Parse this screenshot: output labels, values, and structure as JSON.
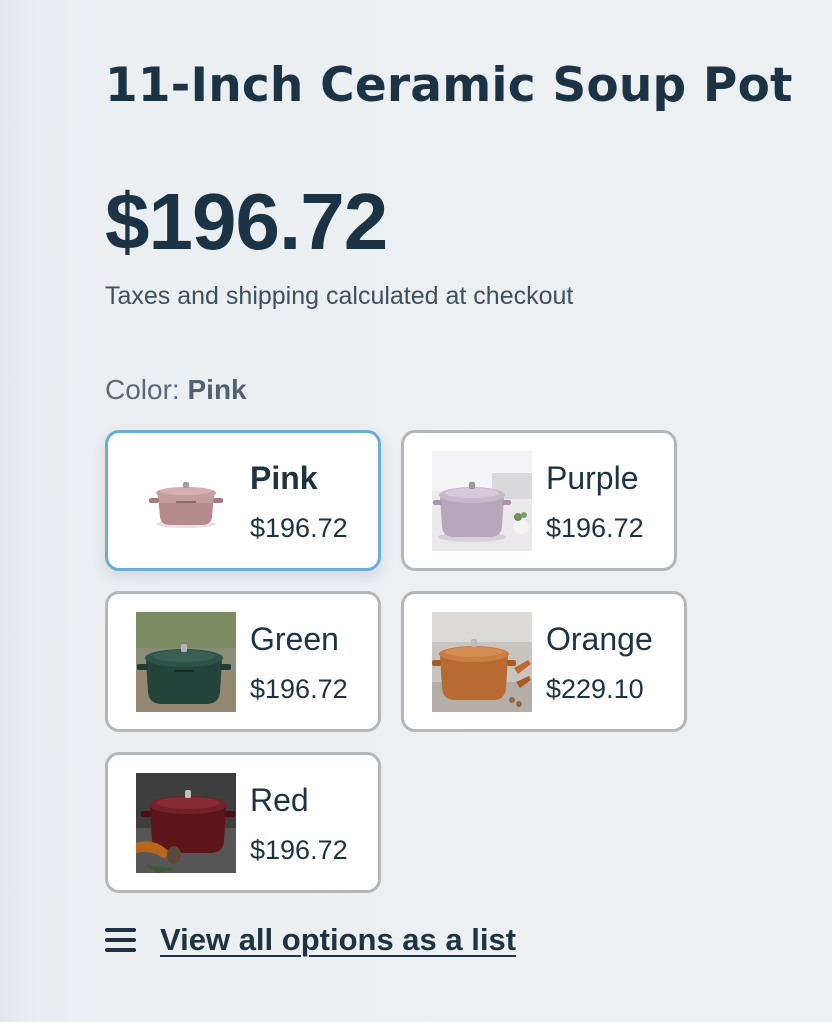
{
  "product": {
    "title": "11-Inch Ceramic Soup Pot",
    "price": "$196.72",
    "tax_note": "Taxes and shipping calculated at checkout"
  },
  "color_selector": {
    "label_prefix": "Color:",
    "selected_value": "Pink",
    "options": [
      {
        "name": "Pink",
        "price": "$196.72",
        "selected": true,
        "pot_color": "#b88c8e",
        "bg_color": "#ffffff",
        "image_icon": "pink-pot-image"
      },
      {
        "name": "Purple",
        "price": "$196.72",
        "selected": false,
        "pot_color": "#b8a8bc",
        "bg_color": "#e9e7ea",
        "image_icon": "purple-pot-image"
      },
      {
        "name": "Green",
        "price": "$196.72",
        "selected": false,
        "pot_color": "#2b4a40",
        "bg_color": "#7d8a6e",
        "image_icon": "green-pot-image"
      },
      {
        "name": "Orange",
        "price": "$229.10",
        "selected": false,
        "pot_color": "#c0743a",
        "bg_color": "#bdbab6",
        "image_icon": "orange-pot-image"
      },
      {
        "name": "Red",
        "price": "$196.72",
        "selected": false,
        "pot_color": "#6b1d22",
        "bg_color": "#4a4a4a",
        "image_icon": "red-pot-image"
      }
    ]
  },
  "view_all_link": {
    "label": "View all options as a list",
    "icon": "list-menu-icon"
  },
  "colors": {
    "text": "#1d3342",
    "selected_border": "#6aaed6",
    "card_border": "#b4b7ba"
  }
}
